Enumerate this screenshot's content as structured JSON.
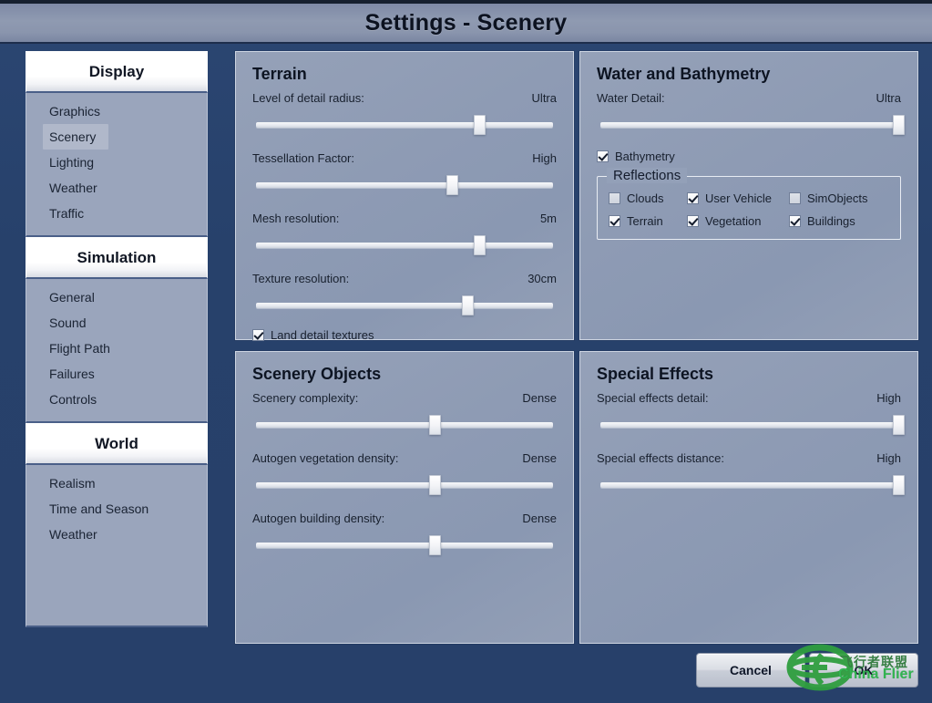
{
  "window": {
    "title": "Settings - Scenery"
  },
  "sidebar": {
    "groups": [
      {
        "header": "Display",
        "items": [
          {
            "label": "Graphics",
            "selected": false
          },
          {
            "label": "Scenery",
            "selected": true
          },
          {
            "label": "Lighting",
            "selected": false
          },
          {
            "label": "Weather",
            "selected": false
          },
          {
            "label": "Traffic",
            "selected": false
          }
        ]
      },
      {
        "header": "Simulation",
        "items": [
          {
            "label": "General",
            "selected": false
          },
          {
            "label": "Sound",
            "selected": false
          },
          {
            "label": "Flight Path",
            "selected": false
          },
          {
            "label": "Failures",
            "selected": false
          },
          {
            "label": "Controls",
            "selected": false
          }
        ]
      },
      {
        "header": "World",
        "items": [
          {
            "label": "Realism",
            "selected": false
          },
          {
            "label": "Time and Season",
            "selected": false
          },
          {
            "label": "Weather",
            "selected": false
          }
        ]
      }
    ]
  },
  "panels": {
    "terrain": {
      "title": "Terrain",
      "sliders": [
        {
          "label": "Level of detail radius:",
          "value": "Ultra",
          "percent": 75
        },
        {
          "label": "Tessellation Factor:",
          "value": "High",
          "percent": 66
        },
        {
          "label": "Mesh resolution:",
          "value": "5m",
          "percent": 75
        },
        {
          "label": "Texture resolution:",
          "value": "30cm",
          "percent": 71
        }
      ],
      "checkbox": {
        "label": "Land detail textures",
        "checked": true
      }
    },
    "water": {
      "title": "Water and Bathymetry",
      "sliders": [
        {
          "label": "Water Detail:",
          "value": "Ultra",
          "percent": 100
        }
      ],
      "bathymetry": {
        "label": "Bathymetry",
        "checked": true
      },
      "reflections": {
        "legend": "Reflections",
        "items": [
          {
            "label": "Clouds",
            "checked": false
          },
          {
            "label": "User Vehicle",
            "checked": true
          },
          {
            "label": "SimObjects",
            "checked": false
          },
          {
            "label": "Terrain",
            "checked": true
          },
          {
            "label": "Vegetation",
            "checked": true
          },
          {
            "label": "Buildings",
            "checked": true
          }
        ]
      }
    },
    "scenery_objects": {
      "title": "Scenery Objects",
      "sliders": [
        {
          "label": "Scenery complexity:",
          "value": "Dense",
          "percent": 60
        },
        {
          "label": "Autogen vegetation density:",
          "value": "Dense",
          "percent": 60
        },
        {
          "label": "Autogen building density:",
          "value": "Dense",
          "percent": 60
        }
      ]
    },
    "special_effects": {
      "title": "Special Effects",
      "sliders": [
        {
          "label": "Special effects detail:",
          "value": "High",
          "percent": 100
        },
        {
          "label": "Special effects distance:",
          "value": "High",
          "percent": 100
        }
      ]
    }
  },
  "buttons": {
    "cancel": "Cancel",
    "ok": "OK"
  },
  "watermark": {
    "chinese": "飞行者联盟",
    "english": "China Flier"
  },
  "colors": {
    "window_background": "#27416b",
    "titlebar": "#8f9ab1",
    "panel_background": "#8e9bb4",
    "sidebar_items": "#9aa5bc",
    "watermark_green": "#2bb24a"
  }
}
